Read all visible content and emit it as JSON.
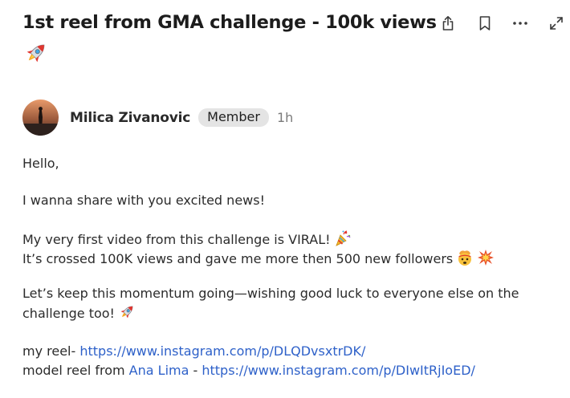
{
  "post": {
    "title": "1st reel from GMA challenge - 100k views",
    "title_emoji": "rocket-emoji"
  },
  "actions": {
    "icons": [
      "share-icon",
      "bookmark-icon",
      "more-icon",
      "expand-icon"
    ]
  },
  "author": {
    "name": "Milica Zivanovic",
    "badge": "Member",
    "time": "1h"
  },
  "body": {
    "hello": "Hello,",
    "share": "I wanna share with you excited news!",
    "viral": "My very first video from this challenge is VIRAL!",
    "crossed": "It’s crossed 100K views  and gave me more then 500 new followers",
    "momentum": "Let’s keep this momentum going—wishing good luck to everyone else on the challenge too!",
    "reel_label": "my reel- ",
    "reel_url": "https://www.instagram.com/p/DLQDvsxtrDK/",
    "model_label": "model reel from ",
    "model_name": "Ana Lima",
    "model_sep": " - ",
    "model_url": "https://www.instagram.com/p/DIwItRjIoED/"
  },
  "colors": {
    "link": "#2e61c9",
    "badge_bg": "#e4e4e4",
    "muted": "#7a7a7a"
  }
}
